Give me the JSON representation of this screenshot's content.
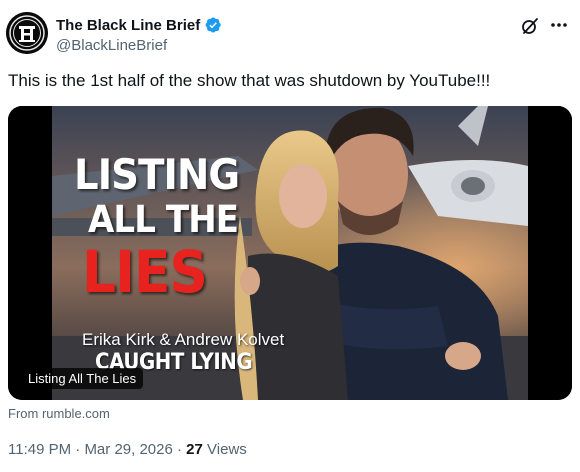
{
  "author": {
    "display_name": "The Black Line Brief",
    "handle": "@BlackLineBrief",
    "verified": true
  },
  "icons": {
    "verified": "verified-badge-icon",
    "grok": "grok-icon",
    "more": "more-options-icon"
  },
  "tweet": {
    "text": "This is the 1st half of the show that was shutdown by YouTube!!!"
  },
  "media": {
    "thumbnail_title_line1": "LISTING",
    "thumbnail_title_line2": "ALL THE",
    "thumbnail_title_line3": "LIES",
    "thumbnail_subtitle": "Erika Kirk & Andrew Kolvet",
    "thumbnail_caption": "CAUGHT LYING",
    "label": "Listing All The Lies",
    "source": "From rumble.com"
  },
  "meta": {
    "time": "11:49 PM",
    "separator": "·",
    "date": "Mar 29, 2026",
    "views_count": "27",
    "views_label": "Views"
  },
  "colors": {
    "verified_blue": "#1d9bf0",
    "title_red": "#e8231f",
    "secondary_text": "#536471"
  }
}
